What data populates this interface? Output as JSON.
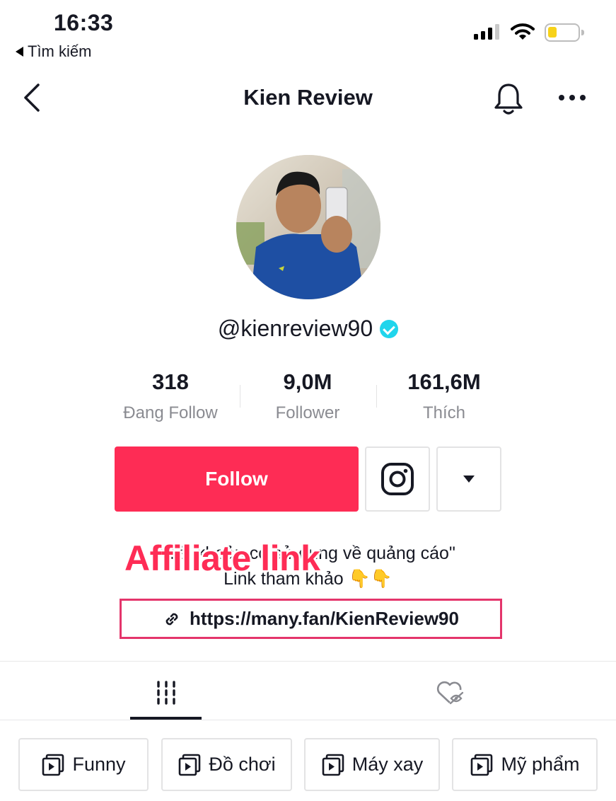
{
  "status_bar": {
    "time": "16:33",
    "back_label": "Tìm kiếm"
  },
  "nav": {
    "title": "Kien Review"
  },
  "profile": {
    "username": "@kienreview90",
    "verified": true
  },
  "stats": [
    {
      "value": "318",
      "label": "Đang Follow"
    },
    {
      "value": "9,0M",
      "label": "Follower"
    },
    {
      "value": "161,6M",
      "label": "Thích"
    }
  ],
  "actions": {
    "follow_label": "Follow"
  },
  "bio": {
    "line1": "\"Tài khoản có sử dụng về quảng cáo\"",
    "line2": "Link tham khảo 👇👇",
    "overlay_label": "Affiliate link",
    "link": "https://many.fan/KienReview90"
  },
  "playlists": [
    {
      "label": "Funny"
    },
    {
      "label": "Đồ chơi"
    },
    {
      "label": "Máy xay"
    },
    {
      "label": "Mỹ phẩm"
    }
  ],
  "colors": {
    "accent": "#fe2c55",
    "verified": "#20d5ec",
    "text": "#161823",
    "muted": "#8a8b91",
    "battery": "#f7d21a"
  }
}
